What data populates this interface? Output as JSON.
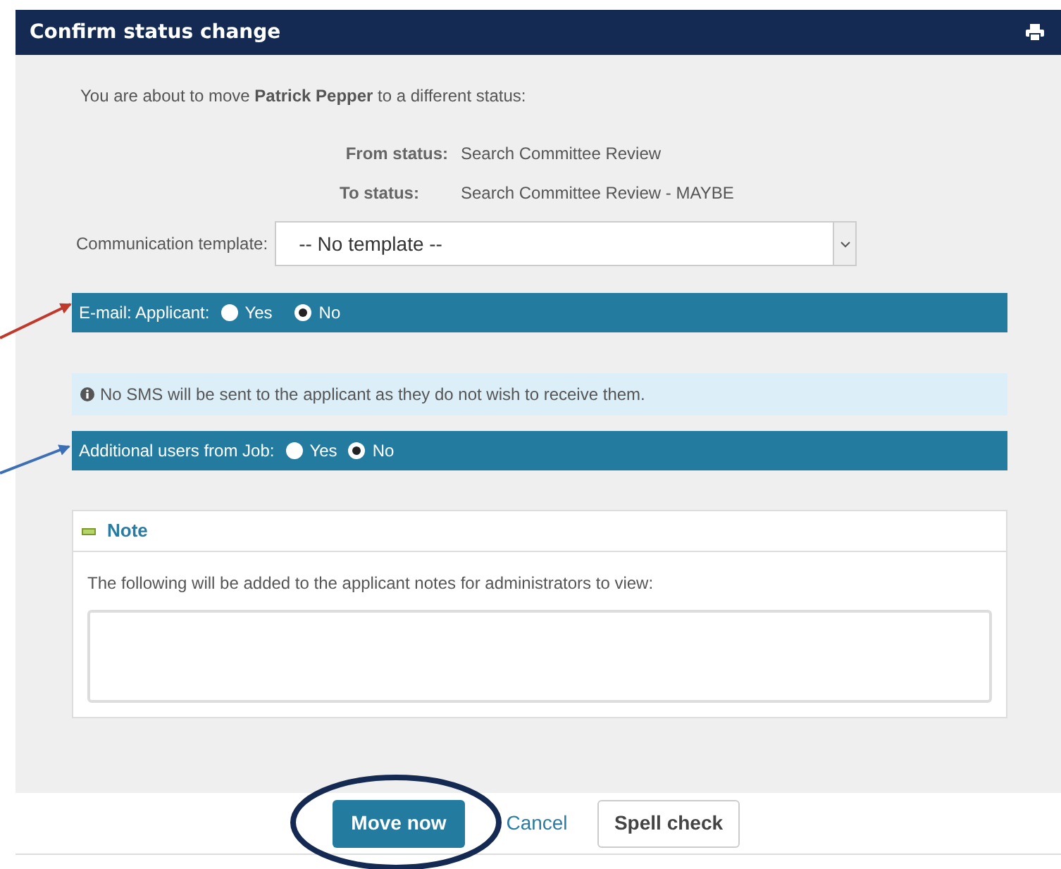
{
  "dialog": {
    "title": "Confirm status change"
  },
  "intro": "You are about to move **Patrick Pepper** to a different status:",
  "status_rows": [
    {
      "label": "From status:",
      "value": "Search Committee Review"
    },
    {
      "label": "To status:",
      "value": "Search Committee Review - MAYBE"
    }
  ],
  "template": {
    "label": "Communication template:",
    "value": "-- No template --"
  },
  "option_groups": [
    {
      "kind": "bar",
      "label": "E-mail: Applicant:",
      "options": [
        {
          "label": "Yes",
          "selected": false
        },
        {
          "label": "No",
          "selected": true
        }
      ]
    },
    {
      "kind": "info",
      "text": "No SMS will be sent to the applicant as they do not wish to receive them."
    },
    {
      "kind": "bar",
      "label": "Additional users from Job:",
      "options": [
        {
          "label": "Yes",
          "selected": false
        },
        {
          "label": "No",
          "selected": true
        }
      ]
    }
  ],
  "note": {
    "title": "Note",
    "expanded": true,
    "description": "The following will be added to the applicant notes for administrators to view:"
  },
  "buttons": [
    {
      "kind": "primary",
      "label": "Move now"
    },
    {
      "kind": "link",
      "label": "Cancel"
    },
    {
      "kind": "default",
      "label": "Spell check"
    }
  ]
}
